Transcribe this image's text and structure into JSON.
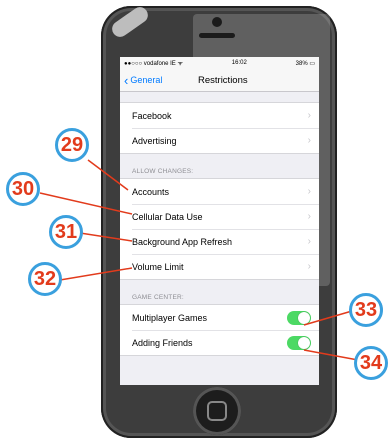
{
  "status_bar": {
    "carrier": "●●○○○ vodafone IE ᯤ",
    "time": "16:02",
    "battery": "38% ▭"
  },
  "nav": {
    "back_label": "General",
    "title": "Restrictions"
  },
  "top_group": [
    {
      "label": "Facebook"
    },
    {
      "label": "Advertising"
    }
  ],
  "allow_changes": {
    "header": "ALLOW CHANGES:",
    "items": [
      {
        "label": "Accounts"
      },
      {
        "label": "Cellular Data Use"
      },
      {
        "label": "Background App Refresh"
      },
      {
        "label": "Volume Limit"
      }
    ]
  },
  "game_center": {
    "header": "GAME CENTER:",
    "items": [
      {
        "label": "Multiplayer Games",
        "enabled": true
      },
      {
        "label": "Adding Friends",
        "enabled": true
      }
    ]
  },
  "callouts": [
    "29",
    "30",
    "31",
    "32",
    "33",
    "34"
  ],
  "colors": {
    "callout_border": "#3aa0de",
    "callout_text": "#e23b1c",
    "pointer_line": "#e23b1c",
    "toggle_on": "#4cd964",
    "link": "#007aff"
  }
}
